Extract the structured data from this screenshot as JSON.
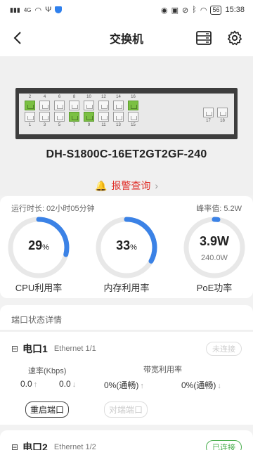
{
  "status_bar": {
    "time": "15:38",
    "battery": "56",
    "signal": "4G"
  },
  "header": {
    "title": "交换机"
  },
  "device": {
    "model": "DH-S1800C-16ET2GT2GF-240",
    "top_ports": [
      "2",
      "4",
      "6",
      "8",
      "10",
      "12",
      "14",
      "16"
    ],
    "bottom_ports": [
      "1",
      "3",
      "5",
      "7",
      "9",
      "11",
      "13",
      "15"
    ],
    "uplink_ports": [
      "17",
      "18"
    ],
    "active_ports": [
      "2",
      "7",
      "9",
      "16"
    ]
  },
  "alarm": {
    "label": "报警查询"
  },
  "metrics": {
    "uptime": "运行时长: 02小时05分钟",
    "peak": "峰率值: 5.2W",
    "cpu": {
      "value": "29",
      "unit": "%",
      "label": "CPU利用率",
      "fraction": 0.29
    },
    "mem": {
      "value": "33",
      "unit": "%",
      "label": "内存利用率",
      "fraction": 0.33
    },
    "poe": {
      "value": "3.9W",
      "sub": "240.0W",
      "label": "PoE功率",
      "fraction": 0.02
    }
  },
  "ports_section": {
    "title": "端口状态详情"
  },
  "ports": [
    {
      "name": "电口1",
      "desc": "Ethernet 1/1",
      "status": "未连接",
      "rate_label": "速率(Kbps)",
      "bw_label": "带宽利用率",
      "up": "0.0",
      "down": "0.0",
      "bw_up": "0%(通畅)",
      "bw_down": "0%(通畅)",
      "restart": "重启端口",
      "peer": "对端端口"
    },
    {
      "name": "电口2",
      "desc": "Ethernet 1/2",
      "status": "已连接"
    }
  ]
}
